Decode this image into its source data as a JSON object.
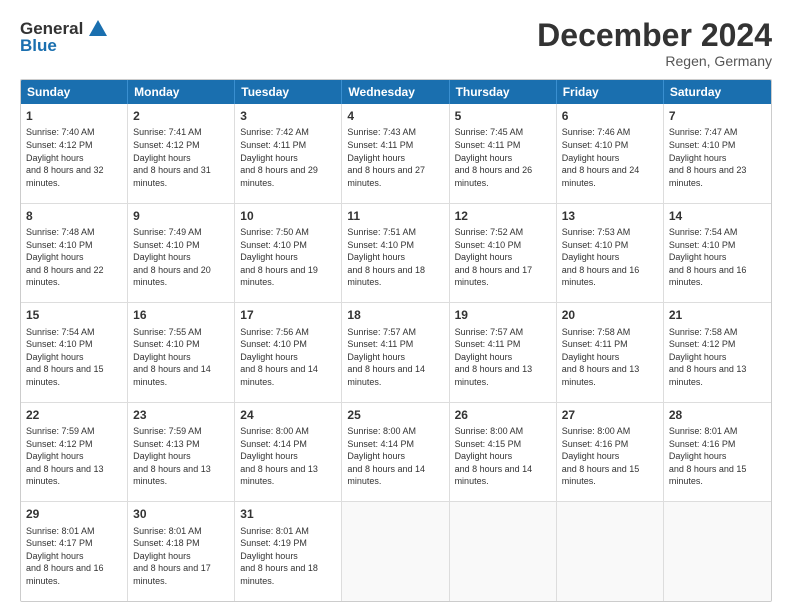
{
  "logo": {
    "general": "General",
    "blue": "Blue"
  },
  "title": "December 2024",
  "location": "Regen, Germany",
  "headers": [
    "Sunday",
    "Monday",
    "Tuesday",
    "Wednesday",
    "Thursday",
    "Friday",
    "Saturday"
  ],
  "weeks": [
    [
      {
        "day": "1",
        "sunrise": "7:40 AM",
        "sunset": "4:12 PM",
        "daylight": "8 hours and 32 minutes."
      },
      {
        "day": "2",
        "sunrise": "7:41 AM",
        "sunset": "4:12 PM",
        "daylight": "8 hours and 31 minutes."
      },
      {
        "day": "3",
        "sunrise": "7:42 AM",
        "sunset": "4:11 PM",
        "daylight": "8 hours and 29 minutes."
      },
      {
        "day": "4",
        "sunrise": "7:43 AM",
        "sunset": "4:11 PM",
        "daylight": "8 hours and 27 minutes."
      },
      {
        "day": "5",
        "sunrise": "7:45 AM",
        "sunset": "4:11 PM",
        "daylight": "8 hours and 26 minutes."
      },
      {
        "day": "6",
        "sunrise": "7:46 AM",
        "sunset": "4:10 PM",
        "daylight": "8 hours and 24 minutes."
      },
      {
        "day": "7",
        "sunrise": "7:47 AM",
        "sunset": "4:10 PM",
        "daylight": "8 hours and 23 minutes."
      }
    ],
    [
      {
        "day": "8",
        "sunrise": "7:48 AM",
        "sunset": "4:10 PM",
        "daylight": "8 hours and 22 minutes."
      },
      {
        "day": "9",
        "sunrise": "7:49 AM",
        "sunset": "4:10 PM",
        "daylight": "8 hours and 20 minutes."
      },
      {
        "day": "10",
        "sunrise": "7:50 AM",
        "sunset": "4:10 PM",
        "daylight": "8 hours and 19 minutes."
      },
      {
        "day": "11",
        "sunrise": "7:51 AM",
        "sunset": "4:10 PM",
        "daylight": "8 hours and 18 minutes."
      },
      {
        "day": "12",
        "sunrise": "7:52 AM",
        "sunset": "4:10 PM",
        "daylight": "8 hours and 17 minutes."
      },
      {
        "day": "13",
        "sunrise": "7:53 AM",
        "sunset": "4:10 PM",
        "daylight": "8 hours and 16 minutes."
      },
      {
        "day": "14",
        "sunrise": "7:54 AM",
        "sunset": "4:10 PM",
        "daylight": "8 hours and 16 minutes."
      }
    ],
    [
      {
        "day": "15",
        "sunrise": "7:54 AM",
        "sunset": "4:10 PM",
        "daylight": "8 hours and 15 minutes."
      },
      {
        "day": "16",
        "sunrise": "7:55 AM",
        "sunset": "4:10 PM",
        "daylight": "8 hours and 14 minutes."
      },
      {
        "day": "17",
        "sunrise": "7:56 AM",
        "sunset": "4:10 PM",
        "daylight": "8 hours and 14 minutes."
      },
      {
        "day": "18",
        "sunrise": "7:57 AM",
        "sunset": "4:11 PM",
        "daylight": "8 hours and 14 minutes."
      },
      {
        "day": "19",
        "sunrise": "7:57 AM",
        "sunset": "4:11 PM",
        "daylight": "8 hours and 13 minutes."
      },
      {
        "day": "20",
        "sunrise": "7:58 AM",
        "sunset": "4:11 PM",
        "daylight": "8 hours and 13 minutes."
      },
      {
        "day": "21",
        "sunrise": "7:58 AM",
        "sunset": "4:12 PM",
        "daylight": "8 hours and 13 minutes."
      }
    ],
    [
      {
        "day": "22",
        "sunrise": "7:59 AM",
        "sunset": "4:12 PM",
        "daylight": "8 hours and 13 minutes."
      },
      {
        "day": "23",
        "sunrise": "7:59 AM",
        "sunset": "4:13 PM",
        "daylight": "8 hours and 13 minutes."
      },
      {
        "day": "24",
        "sunrise": "8:00 AM",
        "sunset": "4:14 PM",
        "daylight": "8 hours and 13 minutes."
      },
      {
        "day": "25",
        "sunrise": "8:00 AM",
        "sunset": "4:14 PM",
        "daylight": "8 hours and 14 minutes."
      },
      {
        "day": "26",
        "sunrise": "8:00 AM",
        "sunset": "4:15 PM",
        "daylight": "8 hours and 14 minutes."
      },
      {
        "day": "27",
        "sunrise": "8:00 AM",
        "sunset": "4:16 PM",
        "daylight": "8 hours and 15 minutes."
      },
      {
        "day": "28",
        "sunrise": "8:01 AM",
        "sunset": "4:16 PM",
        "daylight": "8 hours and 15 minutes."
      }
    ],
    [
      {
        "day": "29",
        "sunrise": "8:01 AM",
        "sunset": "4:17 PM",
        "daylight": "8 hours and 16 minutes."
      },
      {
        "day": "30",
        "sunrise": "8:01 AM",
        "sunset": "4:18 PM",
        "daylight": "8 hours and 17 minutes."
      },
      {
        "day": "31",
        "sunrise": "8:01 AM",
        "sunset": "4:19 PM",
        "daylight": "8 hours and 18 minutes."
      },
      null,
      null,
      null,
      null
    ]
  ],
  "labels": {
    "sunrise": "Sunrise:",
    "sunset": "Sunset:",
    "daylight": "Daylight hours"
  }
}
